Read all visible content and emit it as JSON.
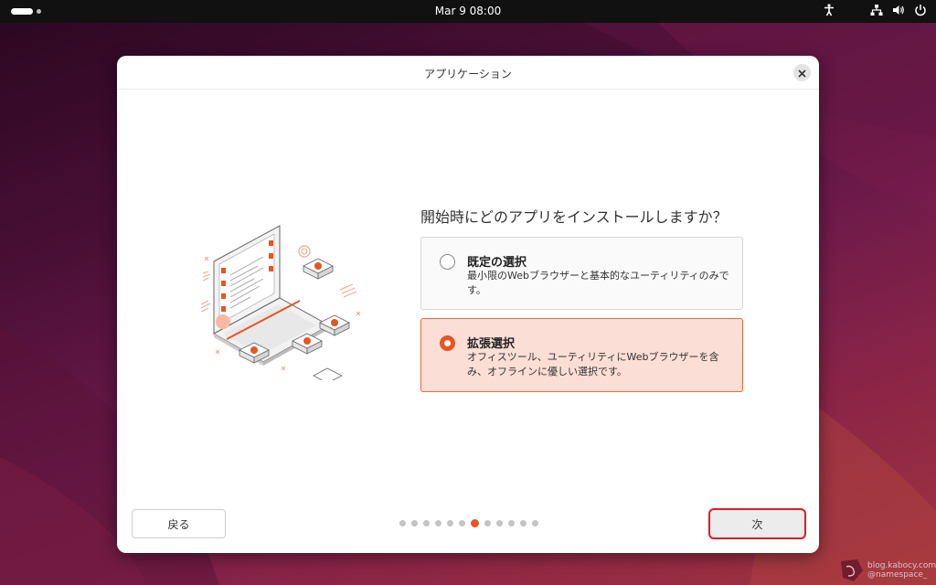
{
  "topbar": {
    "clock": "Mar 9  08:00"
  },
  "dialog": {
    "title": "アプリケーション",
    "question": "開始時にどのアプリをインストールしますか？",
    "options": [
      {
        "title": "既定の選択",
        "description": "最小限のWebブラウザーと基本的なユーティリティのみです。",
        "selected": false
      },
      {
        "title": "拡張選択",
        "description": "オフィスツール、ユーティリティにWebブラウザーを含み、オフラインに優しい選択です。",
        "selected": true
      }
    ],
    "back_label": "戻る",
    "next_label": "次",
    "steps": {
      "total": 12,
      "current": 7
    }
  },
  "watermark": {
    "line1": "blog.kabocy.com",
    "line2": "@namespace_"
  },
  "colors": {
    "accent": "#e95420",
    "selected_bg": "#fbded5",
    "next_border": "#e01b24",
    "topbar": "#111111"
  },
  "icons": {
    "close": "close-icon",
    "accessibility": "accessibility-icon",
    "network": "network-icon",
    "volume": "volume-icon",
    "power": "power-icon"
  }
}
